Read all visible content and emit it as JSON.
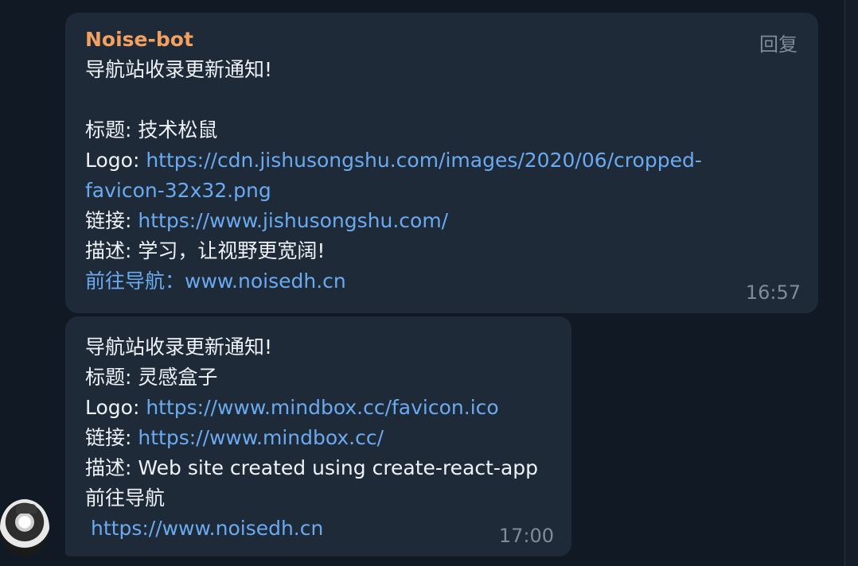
{
  "messages": [
    {
      "sender": "Noise-bot",
      "reply_label": "回复",
      "intro": "导航站收录更新通知!",
      "title_label": "标题: ",
      "title_value": "技术松鼠",
      "logo_label": "Logo: ",
      "logo_link_line1": "https://cdn.jishusongshu.com/images/2020/06/cropped-",
      "logo_link_line2": "favicon-32x32.png",
      "link_label": "链接: ",
      "link_value": "https://www.jishusongshu.com/",
      "desc_label": "描述: ",
      "desc_value": "学习，让视野更宽阔!",
      "nav_link": "前往导航：www.noisedh.cn",
      "time": "16:57"
    },
    {
      "intro": "导航站收录更新通知!",
      "title_label": "标题: ",
      "title_value": "灵感盒子",
      "logo_label": "Logo: ",
      "logo_link": "https://www.mindbox.cc/favicon.ico",
      "link_label": "链接: ",
      "link_value": "https://www.mindbox.cc/",
      "desc_label": "描述: ",
      "desc_value": "Web site created using create-react-app",
      "nav_label": "前往导航",
      "nav_link": "https://www.noisedh.cn",
      "time": "17:00"
    }
  ],
  "colors": {
    "background": "#111924",
    "bubble": "#1e2a38",
    "sender": "#f2a160",
    "link": "#6aaaf0",
    "muted": "#7f8b98",
    "text": "#eef2f6"
  }
}
